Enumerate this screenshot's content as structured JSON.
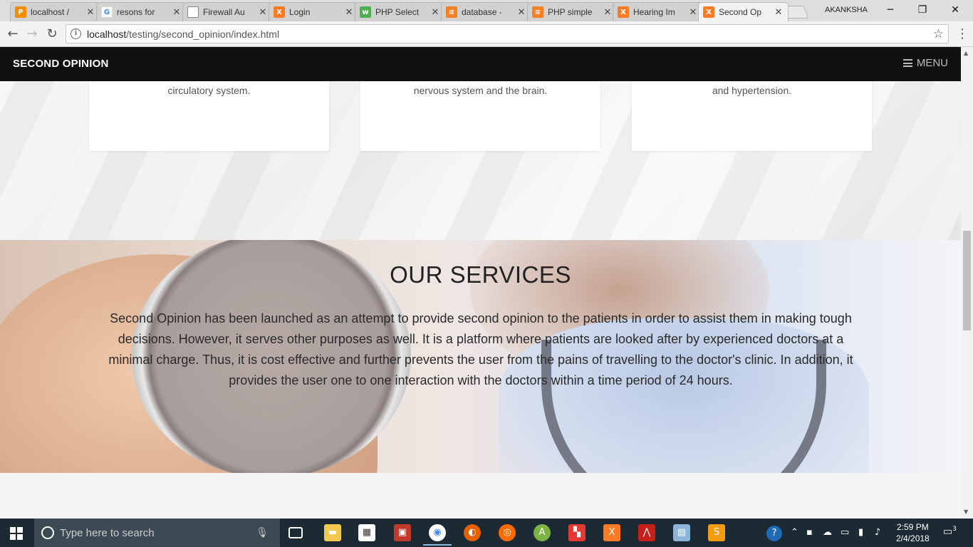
{
  "browser": {
    "tabs": [
      {
        "label": "localhost /",
        "icon": "phpmyadmin-icon",
        "color": "#f28c00"
      },
      {
        "label": "resons for",
        "icon": "google-icon",
        "color": "#4285f4"
      },
      {
        "label": "Firewall Au",
        "icon": "document-icon",
        "color": "#888888"
      },
      {
        "label": "Login",
        "icon": "xampp-icon",
        "color": "#fb7a24"
      },
      {
        "label": "PHP Select",
        "icon": "w3schools-icon",
        "color": "#4caf50"
      },
      {
        "label": "database -",
        "icon": "stackoverflow-icon",
        "color": "#f48024"
      },
      {
        "label": "PHP simple",
        "icon": "stackoverflow-icon",
        "color": "#f48024"
      },
      {
        "label": "Hearing Im",
        "icon": "xampp-icon",
        "color": "#fb7a24"
      },
      {
        "label": "Second Op",
        "icon": "xampp-icon",
        "color": "#fb7a24",
        "active": true
      }
    ],
    "profile": "AKANKSHA",
    "url_host": "localhost",
    "url_path": "/testing/second_opinion/index.html"
  },
  "site": {
    "brand": "SECOND OPINION",
    "menu_label": "MENU",
    "cards": [
      {
        "text": "circulatory system."
      },
      {
        "text": "nervous system and the brain."
      },
      {
        "text": "and hypertension."
      }
    ],
    "services": {
      "title": "OUR SERVICES",
      "body": "Second Opinion has been launched as an attempt to provide second opinion to the patients in order to assist them in making tough decisions. However, it serves other purposes as well. It is a platform where patients are looked after by experienced doctors at a minimal charge. Thus, it is cost effective and further prevents the user from the pains of travelling to the doctor's clinic. In addition, it provides the user one to one interaction with the doctors within a time period of 24 hours."
    }
  },
  "taskbar": {
    "search_placeholder": "Type here to search",
    "time": "2:59 PM",
    "date": "2/4/2018",
    "notification_count": "3"
  }
}
